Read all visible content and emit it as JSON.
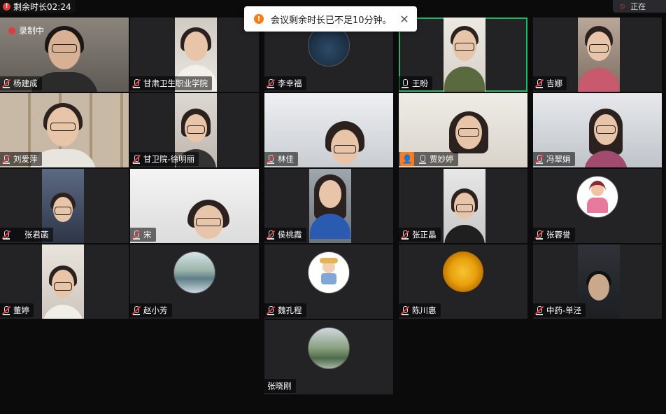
{
  "top_left": {
    "timer_text": "剩余时长02:24"
  },
  "toast": {
    "message": "会议剩余时长已不足10分钟。",
    "close_label": "✕"
  },
  "top_right": {
    "text": "正在"
  },
  "recording_label": "录制中",
  "participants": [
    {
      "name": "杨建成",
      "muted": true
    },
    {
      "name": "甘肃卫生职业学院",
      "muted": true
    },
    {
      "name": "李幸福",
      "muted": true
    },
    {
      "name": "王盼",
      "muted": false,
      "active": true
    },
    {
      "name": "吉娜",
      "muted": true
    },
    {
      "name": "刘爱萍",
      "muted": true
    },
    {
      "name": "甘卫院-徐明丽",
      "muted": true
    },
    {
      "name": "林佳",
      "muted": true
    },
    {
      "name": "贾妙婷",
      "muted": false,
      "host": true
    },
    {
      "name": "冯翠娟",
      "muted": true
    },
    {
      "name": "张君菡",
      "muted": true
    },
    {
      "name": "宋",
      "muted": true
    },
    {
      "name": "侯桃霞",
      "muted": true
    },
    {
      "name": "张正晶",
      "muted": true
    },
    {
      "name": "张蓉誉",
      "muted": true
    },
    {
      "name": "董婷",
      "muted": true
    },
    {
      "name": "赵小芳",
      "muted": true
    },
    {
      "name": "魏孔程",
      "muted": true
    },
    {
      "name": "陈川惠",
      "muted": true
    },
    {
      "name": "中药-单泾",
      "muted": true
    },
    {
      "name": "张晓刚",
      "muted": null
    }
  ],
  "colors": {
    "active_border": "#1fb86b",
    "toast_icon": "#ff7a1a",
    "mute_slash": "#e23b3b"
  }
}
